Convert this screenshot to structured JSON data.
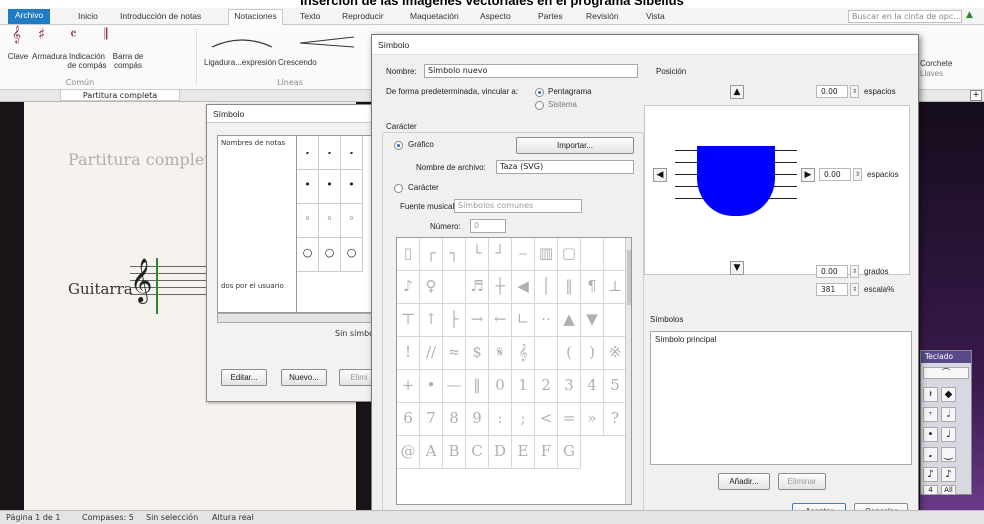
{
  "caption": "Inserción de las imágenes vectoriales en el programa Sibelius",
  "ribbon": {
    "tabs": [
      "Archivo",
      "Inicio",
      "Introducción de notas",
      "Notaciones",
      "Texto",
      "Reproducir",
      "Maquetación",
      "Aspecto",
      "Partes",
      "Revisión",
      "Vista"
    ],
    "search_placeholder": "Buscar en la cinta de opc...",
    "common_buttons": [
      "Clave",
      "Armadura",
      "Indicación de compás",
      "Barra de compás"
    ],
    "common_group": "Común",
    "lines_buttons": [
      "Ligadura...expresión",
      "Crescendo"
    ],
    "lines_group": "Líneas",
    "right_label_1": "Corchete",
    "right_label_2": "Llaves"
  },
  "document": {
    "tab": "Partitura completa",
    "score_title": "Partitura completa",
    "instrument": "Guitarra",
    "clef": "𝄞"
  },
  "back_dialog": {
    "title": "Símbolo",
    "list_items": [
      "Nombres de notas",
      "dos por el usuario"
    ],
    "no_symbol": "Sin símbo",
    "buttons": [
      "Editar...",
      "Nuevo...",
      "Elimi"
    ],
    "grid_symbols": [
      "𝅘",
      "𝅘",
      "𝅘",
      "•",
      "•",
      "•",
      "◦",
      "◦",
      "◦",
      "○",
      "○",
      "○"
    ]
  },
  "dialog": {
    "title": "Símbolo",
    "name_label": "Nombre:",
    "name_value": "Símbolo nuevo",
    "attach_label": "De forma predeterminada, vincular a:",
    "attach_options": [
      "Pentagrama",
      "Sistema"
    ],
    "character_group": "Carácter",
    "graphic_label": "Gráfico",
    "import_button": "Importar...",
    "filename_label": "Nombre de archivo:",
    "filename_value": "Taza (SVG)",
    "char_radio_label": "Carácter",
    "font_label": "Fuente musical:",
    "font_value": "Símbolos comunes",
    "number_label": "Número:",
    "number_value": "0",
    "position_label": "Posición",
    "offset_top": "0.00",
    "offset_right": "0.00",
    "unit_spaces": "espacios",
    "rotation": "0.00",
    "rotation_unit": "grados",
    "scale": "381",
    "scale_unit": "escala%",
    "symbols_group": "Símbolos",
    "symbols_list": [
      "Símbolo principal"
    ],
    "add_button": "Añadir...",
    "delete_button": "Eliminar",
    "ok_button": "Aceptar",
    "cancel_button": "Cancelar",
    "grid_symbols": [
      "▯",
      "┌",
      "┐",
      "└",
      "┘",
      "⎯",
      "▥",
      "▢",
      "",
      "",
      "♪",
      "♀",
      "",
      "♬",
      "┼",
      "◀",
      "│",
      "‖",
      "¶",
      "⊥",
      "⊤",
      "↑",
      "├",
      "→",
      "←",
      "∟",
      "··",
      "▲",
      "▼",
      "",
      "!",
      "//",
      "≈",
      "$",
      "𝄋",
      "𝄞",
      "",
      "(",
      ")",
      "※",
      "+",
      "•",
      "—",
      "‖",
      "0",
      "1",
      "2",
      "3",
      "4",
      "5",
      "6",
      "7",
      "8",
      "9",
      ":",
      ";",
      "<",
      "=",
      "»",
      "?",
      "@",
      "A",
      "B",
      "C",
      "D",
      "E",
      "F",
      "G"
    ]
  },
  "statusbar": {
    "page": "Página 1 de 1",
    "bars": "Compases: 5",
    "selection": "Sin selección",
    "pitch": "Altura real"
  },
  "keypad": {
    "title": "Teclado",
    "keys": [
      "⌒",
      "♭",
      "𝄽",
      "◆",
      "𝄾",
      "𝅗𝅥",
      "•",
      "♩",
      "⏝",
      "𝅘",
      "♪",
      "♪",
      "4",
      "All"
    ]
  }
}
